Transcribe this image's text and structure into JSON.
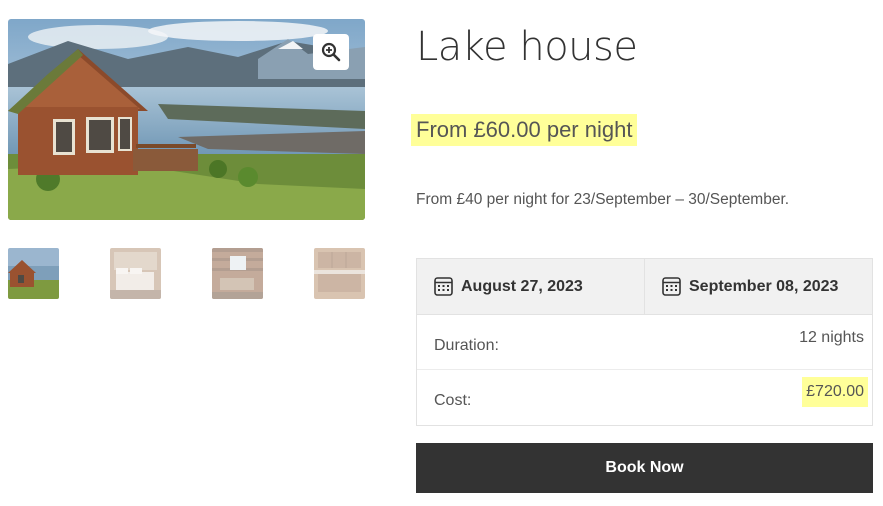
{
  "product": {
    "title": "Lake house",
    "price": "From £60.00 per night",
    "note": "From £40 per night for 23/September – 30/September."
  },
  "gallery": {
    "zoom_icon": "magnifier-plus-icon",
    "thumbnails": [
      "lake-house-exterior",
      "bedroom",
      "cabin-interior",
      "kitchen"
    ]
  },
  "booking": {
    "start_date": "August 27, 2023",
    "end_date": "September 08, 2023",
    "calendar_icon": "calendar-icon",
    "duration_label": "Duration:",
    "duration_value": "12 nights",
    "cost_label": "Cost:",
    "cost_value": "£720.00",
    "book_label": "Book Now"
  },
  "colors": {
    "highlight": "#ffff99",
    "button_bg": "#333333",
    "header_bg": "#f1f1f1"
  }
}
